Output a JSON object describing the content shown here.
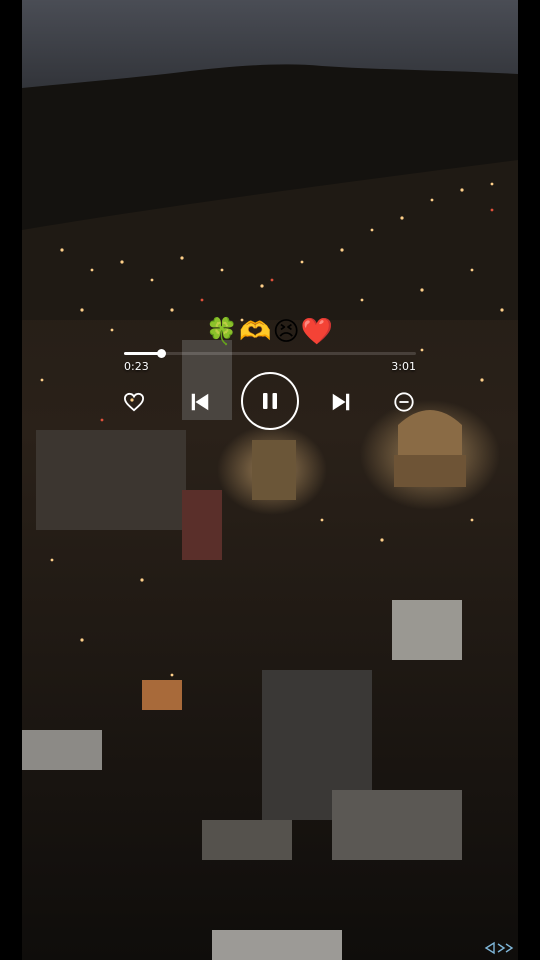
{
  "player": {
    "emoji_title": "🍀🫶😣❤️",
    "elapsed": "0:23",
    "total": "3:01",
    "progress_fraction": 0.127
  },
  "controls": {
    "like_icon": "heart-outline-icon",
    "previous_icon": "skip-previous-icon",
    "play_state_icon": "pause-icon",
    "next_icon": "skip-next-icon",
    "remove_icon": "minus-circle-icon"
  },
  "colors": {
    "ui": "#ffffff",
    "sky": "#3c3f46",
    "hill": "#15130f",
    "city_light": "#f2a35a"
  }
}
